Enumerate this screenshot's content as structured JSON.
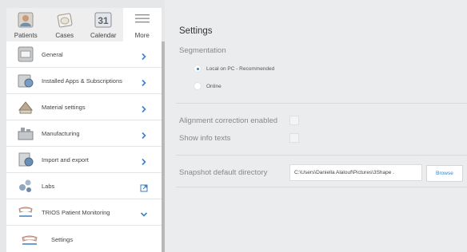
{
  "tabs": [
    {
      "label": "Patients",
      "icon": "patients-icon"
    },
    {
      "label": "Cases",
      "icon": "cases-icon"
    },
    {
      "label": "Calendar",
      "icon": "calendar-icon",
      "day": "31"
    },
    {
      "label": "More",
      "icon": "hamburger-menu-icon",
      "active": true
    }
  ],
  "menu": [
    {
      "label": "General",
      "icon": "general-icon",
      "action": "chevron-right-icon"
    },
    {
      "label": "Installed Apps & Subscriptions",
      "icon": "installed-apps-icon",
      "action": "chevron-right-icon"
    },
    {
      "label": "Material settings",
      "icon": "material-settings-icon",
      "action": "chevron-right-icon"
    },
    {
      "label": "Manufacturing",
      "icon": "manufacturing-icon",
      "action": "chevron-right-icon"
    },
    {
      "label": "Import and export",
      "icon": "import-export-icon",
      "action": "chevron-right-icon"
    },
    {
      "label": "Labs",
      "icon": "labs-icon",
      "action": "external-link-icon"
    },
    {
      "label": "TRIOS Patient Monitoring",
      "icon": "trios-monitoring-icon",
      "action": "chevron-down-icon"
    }
  ],
  "submenu": {
    "label": "Settings",
    "icon": "trios-settings-icon"
  },
  "settings": {
    "title": "Settings",
    "segmentation": {
      "label": "Segmentation",
      "options": [
        {
          "label": "Local on PC - Recommended",
          "checked": true
        },
        {
          "label": "Online",
          "checked": false
        }
      ]
    },
    "alignment_label": "Alignment correction enabled",
    "alignment_checked": false,
    "info_label": "Show info texts",
    "info_checked": false,
    "snapshot_label": "Snapshot default directory",
    "snapshot_path": "C:\\Users\\Daniella Alalouf\\Pictures\\3Shape .",
    "browse_label": "Browse"
  },
  "colors": {
    "accent": "#3b7fc4",
    "background": "#ebeced",
    "panel": "#ffffff"
  }
}
